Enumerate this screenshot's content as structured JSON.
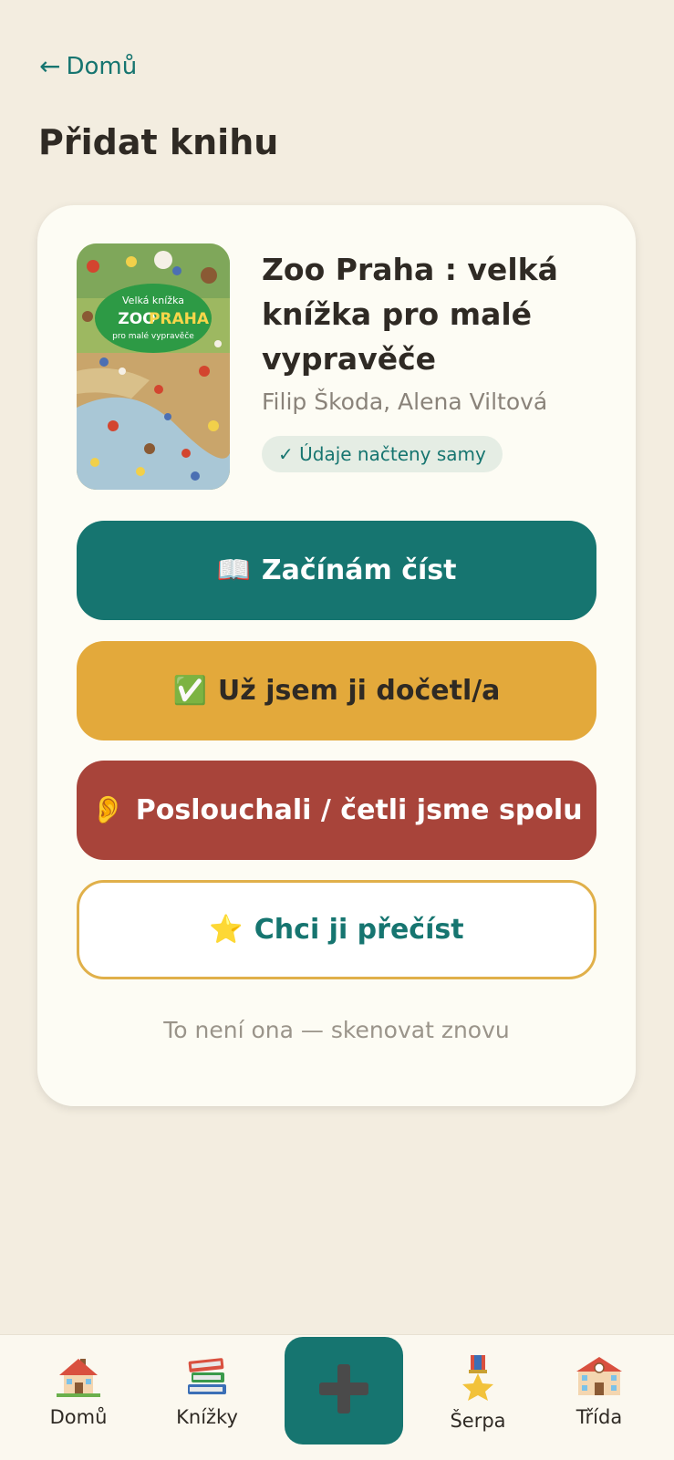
{
  "header": {
    "back_label": "Domů",
    "title": "Přidat knihu"
  },
  "book": {
    "title": "Zoo Praha : velká knížka pro malé vypravěče",
    "author": "Filip Škoda, Alena Viltová",
    "status_badge": "✓ Údaje načteny samy",
    "cover": {
      "top_line": "Velká knížka",
      "zoo": "ZOO",
      "praha": "PRAHA",
      "subtitle": "pro malé vypravěče"
    }
  },
  "actions": {
    "reading": {
      "icon": "📖",
      "label": "Začínám číst"
    },
    "finished": {
      "icon": "✅",
      "label": "Už jsem ji dočetl/a"
    },
    "together": {
      "icon": "👂",
      "label": "Poslouchali / četli jsme spolu"
    },
    "wishlist": {
      "icon": "⭐",
      "label": "Chci ji přečíst"
    },
    "rescan": "To není ona — skenovat znovu"
  },
  "nav": {
    "home": "Domů",
    "books": "Knížky",
    "sherpa": "Šerpa",
    "class": "Třída"
  },
  "colors": {
    "teal": "#167570",
    "mustard": "#e3a93b",
    "brick": "#a8443a",
    "background": "#f3ede0",
    "card": "#fdfcf4"
  }
}
